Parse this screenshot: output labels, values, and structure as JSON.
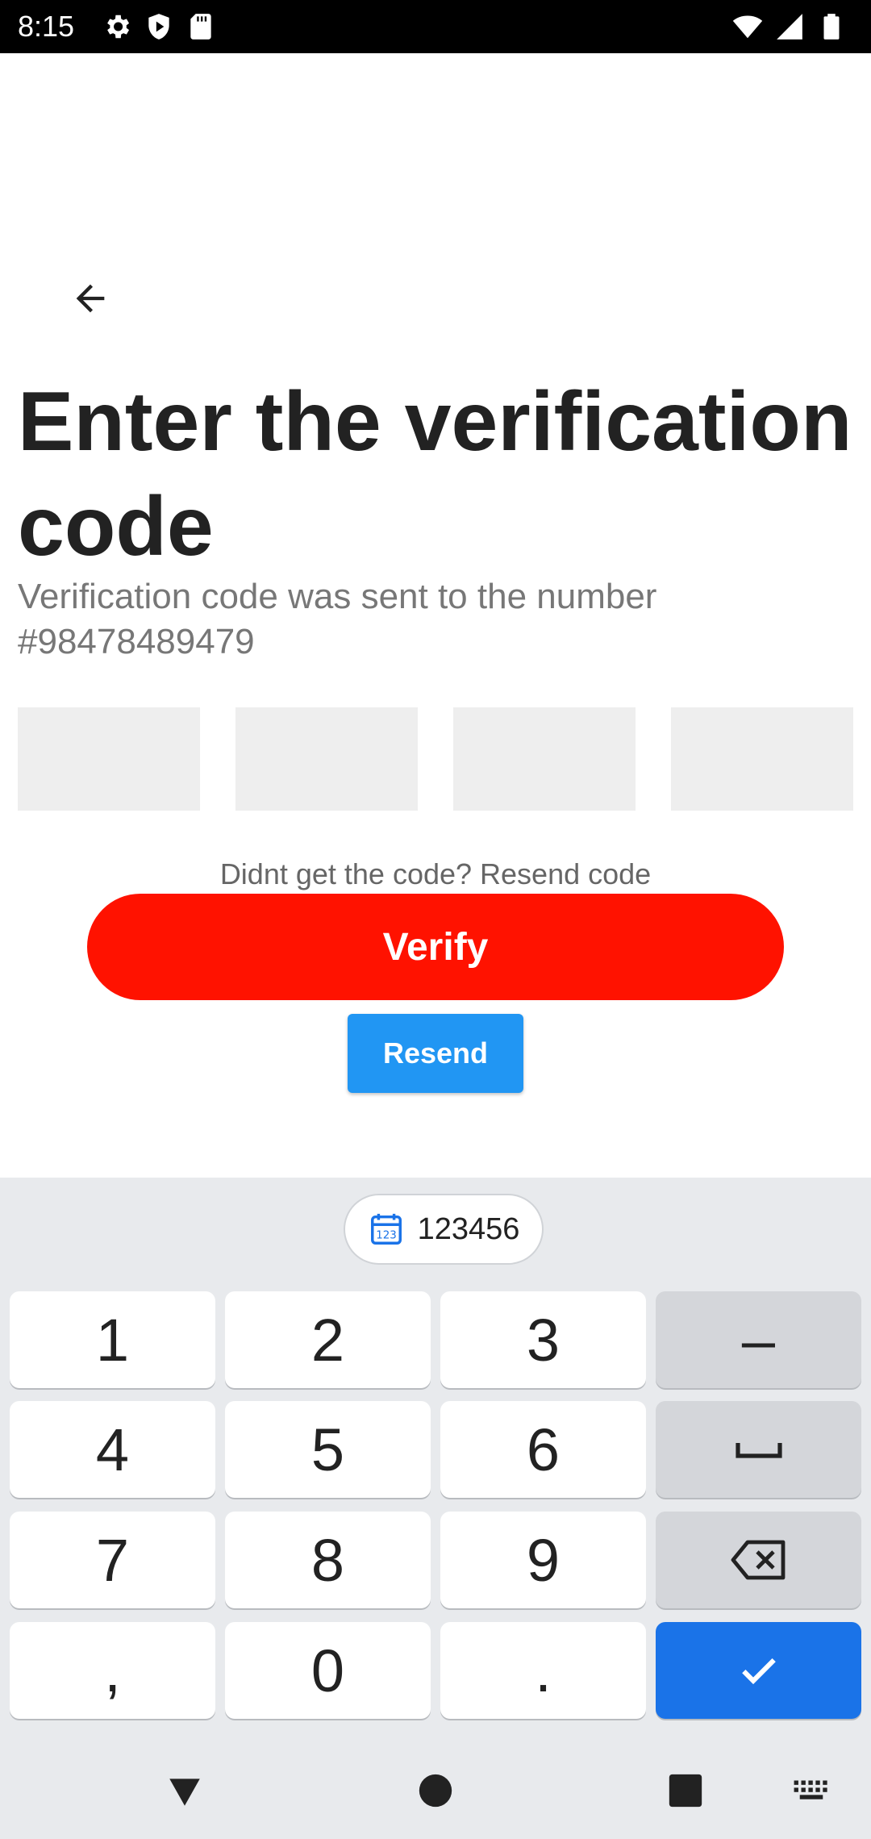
{
  "status_bar": {
    "time": "8:15",
    "left_icons": [
      "gear-icon",
      "shield-play-icon",
      "sd-card-icon"
    ],
    "right_icons": [
      "wifi-icon",
      "signal-icon",
      "battery-icon"
    ]
  },
  "header": {
    "title": "Enter the verification code",
    "subtitle": "Verification code was sent to the number #98478489479"
  },
  "otp": {
    "digits": [
      "",
      "",
      "",
      ""
    ]
  },
  "resend_prompt": "Didnt get the code? Resend code",
  "buttons": {
    "verify_label": "Verify",
    "resend_label": "Resend"
  },
  "keyboard": {
    "suggestion": "123456",
    "rows": [
      [
        "1",
        "2",
        "3",
        "–"
      ],
      [
        "4",
        "5",
        "6",
        "␣"
      ],
      [
        "7",
        "8",
        "9",
        "⌫"
      ],
      [
        ",",
        "0",
        ".",
        "✓"
      ]
    ]
  },
  "colors": {
    "verify": "#ff1200",
    "resend": "#2196f3",
    "enter_key": "#1a73e8"
  }
}
